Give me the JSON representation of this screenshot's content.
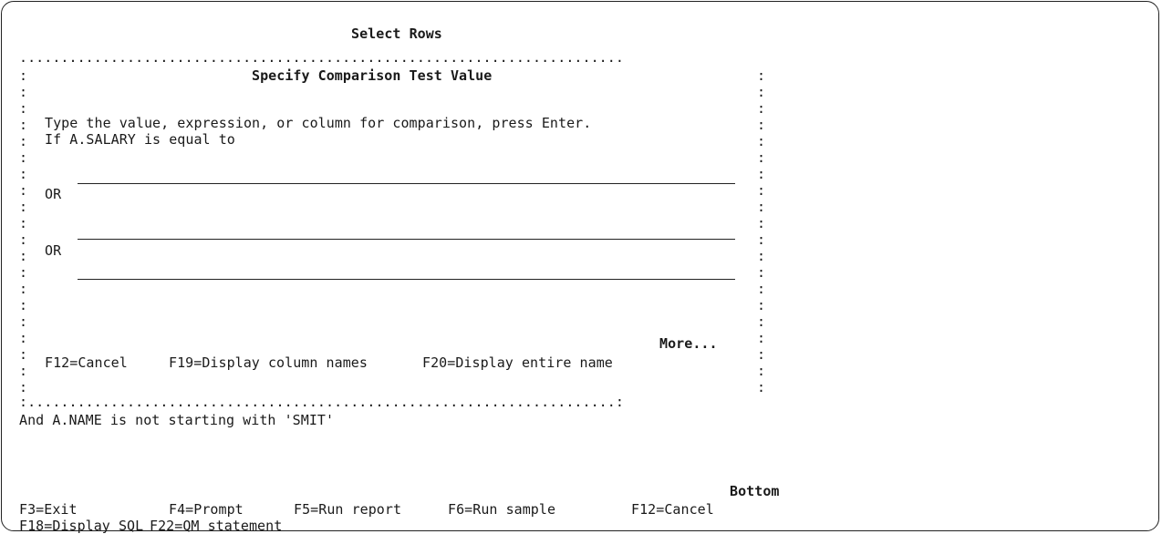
{
  "screen": {
    "title": "Select Rows",
    "lower_condition": "And A.NAME is not starting with 'SMIT'",
    "position_indicator": "Bottom",
    "fkeys_row1": [
      "F3=Exit",
      "F4=Prompt",
      "F5=Run report",
      "F6=Run sample",
      "F12=Cancel"
    ],
    "fkeys_row2": [
      "F18=Display SQL",
      "F22=QM statement"
    ]
  },
  "popup": {
    "title": "Specify Comparison Test Value",
    "instruction": "Type the value, expression, or column for comparison, press Enter.",
    "condition": "If A.SALARY is equal to",
    "values": [
      "",
      "",
      ""
    ],
    "or_label": "OR",
    "more": "More...",
    "fkeys": [
      "F12=Cancel",
      "F19=Display column names",
      "F20=Display entire name"
    ]
  }
}
